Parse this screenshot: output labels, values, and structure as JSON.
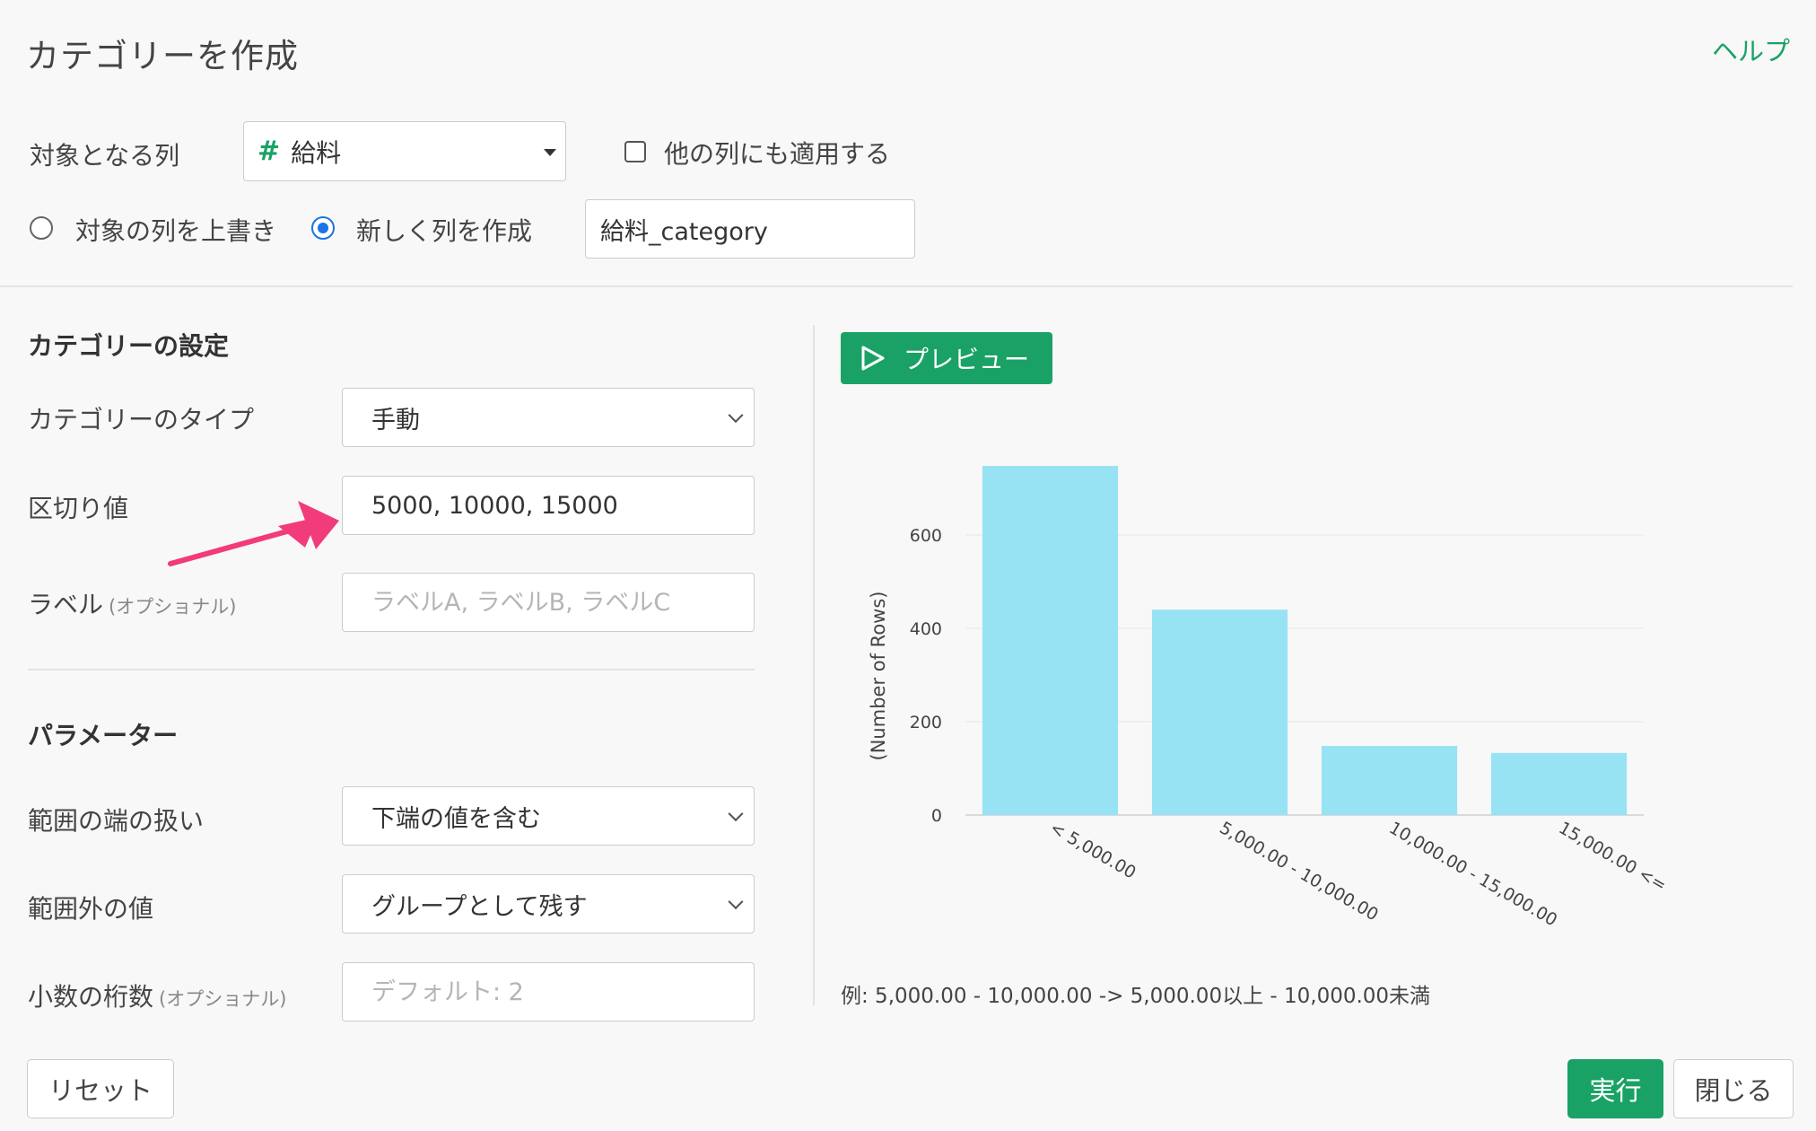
{
  "dialog": {
    "title": "カテゴリーを作成",
    "help": "ヘルプ"
  },
  "target": {
    "label": "対象となる列",
    "column": "給料",
    "apply_other": "他の列にも適用する",
    "overwrite_label": "対象の列を上書き",
    "create_label": "新しく列を作成",
    "new_column_value": "給料_category"
  },
  "category_settings": {
    "title": "カテゴリーの設定",
    "type_label": "カテゴリーのタイプ",
    "type_value": "手動",
    "breaks_label": "区切り値",
    "breaks_value": "5000, 10000, 15000",
    "labels_label": "ラベル",
    "labels_optional": "(オプショナル)",
    "labels_placeholder": "ラベルA, ラベルB, ラベルC"
  },
  "parameters": {
    "title": "パラメーター",
    "edge_label": "範囲の端の扱い",
    "edge_value": "下端の値を含む",
    "outside_label": "範囲外の値",
    "outside_value": "グループとして残す",
    "decimals_label": "小数の桁数",
    "decimals_optional": "(オプショナル)",
    "decimals_placeholder": "デフォルト: 2"
  },
  "preview": {
    "button_label": "プレビュー"
  },
  "chart_data": {
    "type": "bar",
    "categories": [
      "< 5,000.00",
      "5,000.00 - 10,000.00",
      "10,000.00 - 15,000.00",
      "15,000.00 <="
    ],
    "values": [
      748,
      440,
      148,
      133
    ],
    "ylabel": "(Number of Rows)",
    "yticks": [
      0,
      200,
      400,
      600
    ],
    "ylim": [
      0,
      750
    ],
    "bar_color": "#98e3f3",
    "grid": true
  },
  "example": "例: 5,000.00 - 10,000.00 -> 5,000.00以上 - 10,000.00未満",
  "footer": {
    "reset": "リセット",
    "execute": "実行",
    "close": "閉じる"
  },
  "colors": {
    "accent": "#1aa266",
    "arrow": "#f23b7a"
  }
}
